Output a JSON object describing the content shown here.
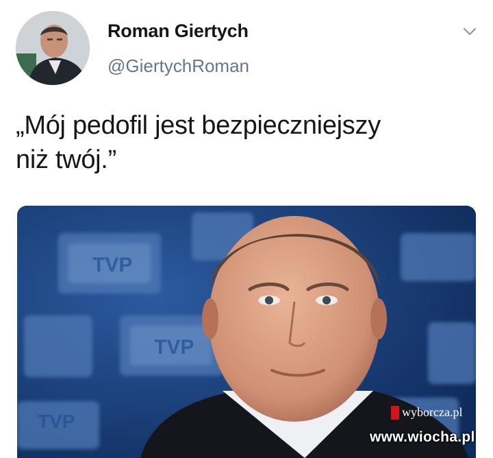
{
  "tweet": {
    "author_name": "Roman Giertych",
    "author_handle": "@GiertychRoman",
    "text_line1": "„Mój pedofil jest bezpieczniejszy",
    "text_line2": "niż twój.”"
  },
  "media": {
    "backdrop_logo_text": "TVP",
    "source_label": "wyborcza.pl"
  },
  "watermark": "www.wiocha.pl",
  "icons": {
    "menu": "chevron-down-icon",
    "avatar": "avatar",
    "source_mark": "red-bar"
  },
  "colors": {
    "text": "#14171a",
    "handle": "#657786",
    "photo_background": "#163b74",
    "source_mark": "#d3141b"
  }
}
